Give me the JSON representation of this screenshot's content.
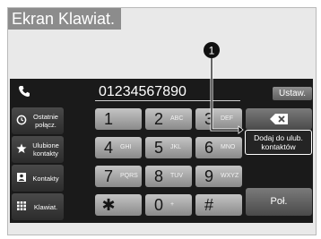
{
  "page_title": "Ekran Klawiat.",
  "callout_number": "1",
  "dial_number": "01234567890",
  "settings_label": "Ustaw.",
  "side_menu": [
    {
      "label": "Ostatnie połącz.",
      "icon": "recent-calls-icon"
    },
    {
      "label": "Ulubione kontakty",
      "icon": "star-icon"
    },
    {
      "label": "Kontakty",
      "icon": "contacts-icon"
    },
    {
      "label": "Klawiat.",
      "icon": "keypad-icon"
    }
  ],
  "keys": [
    {
      "digit": "1",
      "letters": ""
    },
    {
      "digit": "2",
      "letters": "ABC"
    },
    {
      "digit": "3",
      "letters": "DEF"
    },
    {
      "digit": "4",
      "letters": "GHI"
    },
    {
      "digit": "5",
      "letters": "JKL"
    },
    {
      "digit": "6",
      "letters": "MNO"
    },
    {
      "digit": "7",
      "letters": "PQRS"
    },
    {
      "digit": "8",
      "letters": "TUV"
    },
    {
      "digit": "9",
      "letters": "WXYZ"
    },
    {
      "digit": "✱",
      "letters": ""
    },
    {
      "digit": "0",
      "letters": "+"
    },
    {
      "digit": "#",
      "letters": ""
    }
  ],
  "backspace_icon": "backspace-icon",
  "add_to_favorites_label": "Dodaj do ulub. kontaktów",
  "call_label": "Poł."
}
